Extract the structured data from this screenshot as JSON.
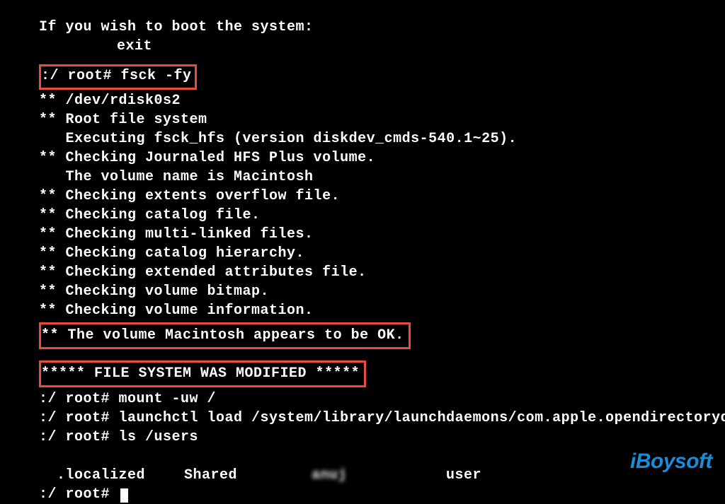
{
  "lines": {
    "l1": "If you wish to boot the system:",
    "l2": "exit",
    "l3": ":/ root# fsck -fy",
    "l4": "** /dev/rdisk0s2",
    "l5": "** Root file system",
    "l6": "   Executing fsck_hfs (version diskdev_cmds-540.1~25).",
    "l7": "** Checking Journaled HFS Plus volume.",
    "l8": "   The volume name is Macintosh",
    "l9": "** Checking extents overflow file.",
    "l10": "** Checking catalog file.",
    "l11": "** Checking multi-linked files.",
    "l12": "** Checking catalog hierarchy.",
    "l13": "** Checking extended attributes file.",
    "l14": "** Checking volume bitmap.",
    "l15": "** Checking volume information.",
    "l16": "** The volume Macintosh appears to be OK.",
    "l17": "***** FILE SYSTEM WAS MODIFIED *****",
    "l18": ":/ root# mount -uw /",
    "l19": ":/ root# launchctl load /system/library/launchdaemons/com.apple.opendirectoryd.plist",
    "l20": ":/ root# ls /users",
    "ls_col1": ".localized",
    "ls_col2": "Shared",
    "ls_col3": "anuj",
    "ls_col4": "user",
    "l22": ":/ root# "
  },
  "watermark": "iBoysoft"
}
